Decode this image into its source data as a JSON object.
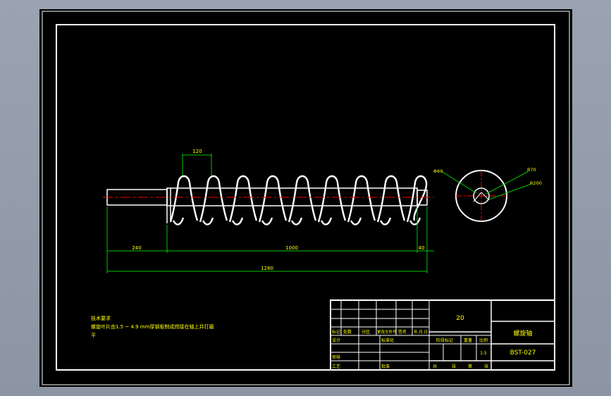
{
  "colors": {
    "background": "#000000",
    "outline": "#ffffff",
    "dimension": "#00c800",
    "text": "#ffff00",
    "centerline": "#ff0000"
  },
  "drawing": {
    "dimensions": {
      "pitch": "120",
      "left_shaft": "240",
      "screw_length": "1000",
      "right_shaft": "40",
      "overall": "1280"
    },
    "section_labels": {
      "bore": "Φ60",
      "outer": "R70",
      "flight": "R200"
    }
  },
  "notes": {
    "heading": "技术要求",
    "line1": "螺旋叶片由1.5 ~ 4.9 mm厚钢板制成焊接在轴上并打磨",
    "line2": "平"
  },
  "title_block": {
    "material": "20",
    "part_name": "螺旋轴",
    "drawing_no": "BST-027",
    "scale": "1:5",
    "header_labels": [
      "标记",
      "处数",
      "分区",
      "更改文件号",
      "签名",
      "年.月.日"
    ],
    "designer_label": "设计",
    "standardize_label": "标准化",
    "review_label": "审核",
    "process_label": "工艺",
    "approve_label": "批准",
    "stage_label": "阶段标记",
    "weight_label": "重量",
    "ratio_label": "比例",
    "sheet_labels": [
      "共",
      "张",
      "第",
      "张"
    ]
  }
}
